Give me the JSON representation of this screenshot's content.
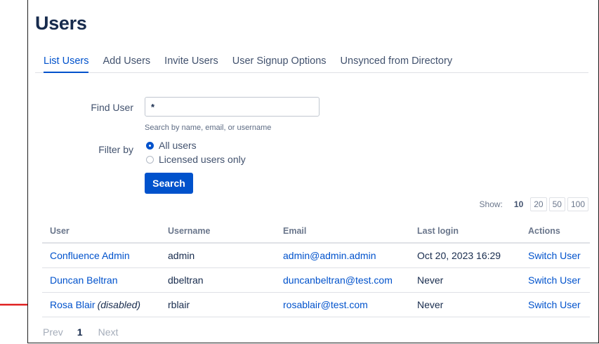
{
  "page": {
    "title": "Users"
  },
  "tabs": [
    {
      "label": "List Users",
      "active": true
    },
    {
      "label": "Add Users"
    },
    {
      "label": "Invite Users"
    },
    {
      "label": "User Signup Options"
    },
    {
      "label": "Unsynced from Directory"
    }
  ],
  "search": {
    "find_label": "Find User",
    "value": "*",
    "hint": "Search by name, email, or username",
    "filter_label": "Filter by",
    "filter_options": [
      {
        "label": "All users",
        "checked": true
      },
      {
        "label": "Licensed users only",
        "checked": false
      }
    ],
    "button_label": "Search"
  },
  "show": {
    "label": "Show:",
    "current": "10",
    "options": [
      "20",
      "50",
      "100"
    ]
  },
  "table": {
    "columns": [
      "User",
      "Username",
      "Email",
      "Last login",
      "Actions"
    ],
    "rows": [
      {
        "user": "Confluence Admin",
        "disabled": "",
        "username": "admin",
        "email": "admin@admin.admin",
        "last_login": "Oct 20, 2023 16:29",
        "action": "Switch User"
      },
      {
        "user": "Duncan Beltran",
        "disabled": "",
        "username": "dbeltran",
        "email": "duncanbeltran@test.com",
        "last_login": "Never",
        "action": "Switch User"
      },
      {
        "user": "Rosa Blair",
        "disabled": "(disabled)",
        "username": "rblair",
        "email": "rosablair@test.com",
        "last_login": "Never",
        "action": "Switch User"
      }
    ]
  },
  "pager": {
    "prev": "Prev",
    "current": "1",
    "next": "Next"
  },
  "colors": {
    "accent": "#0052cc",
    "arrow": "#e02020"
  },
  "icons": {
    "annotation": "red-arrow-icon"
  }
}
